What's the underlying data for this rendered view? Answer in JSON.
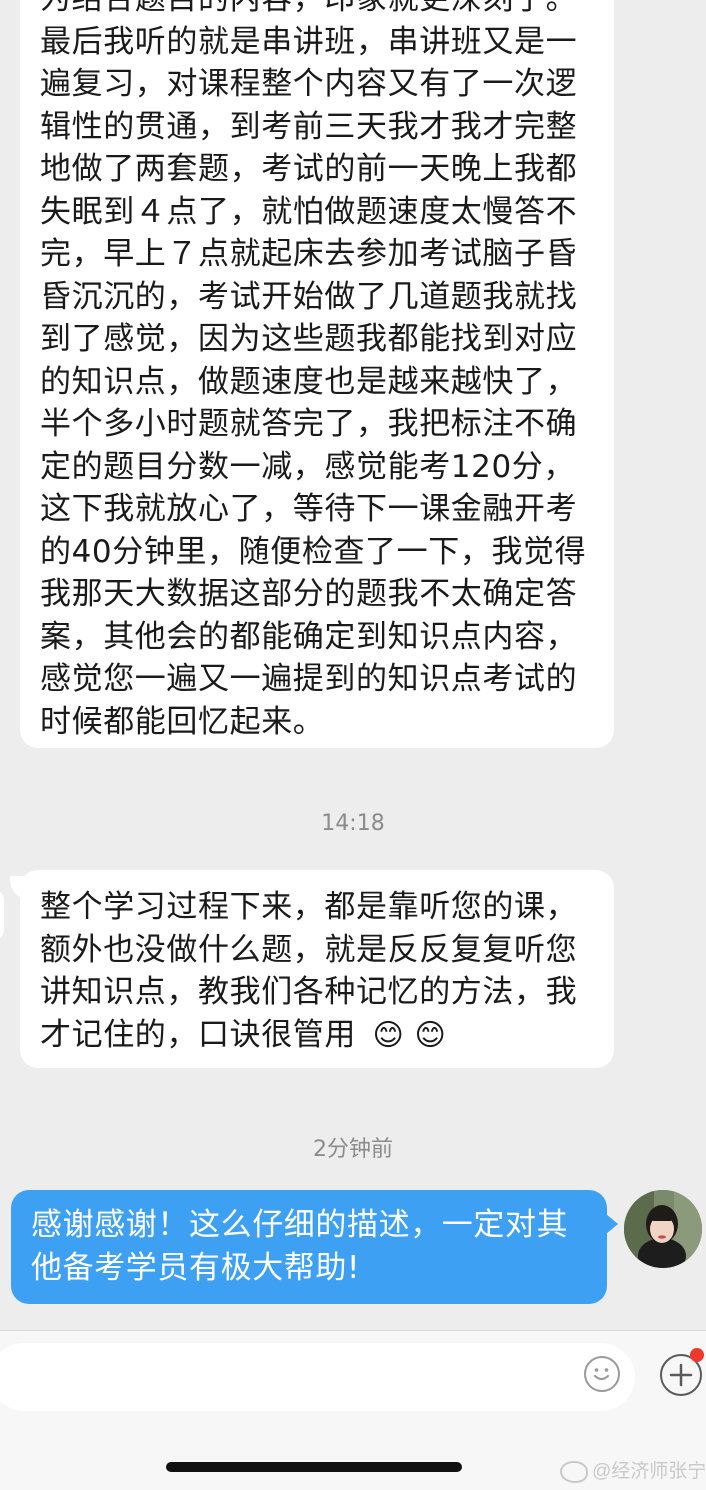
{
  "messages": [
    {
      "text": "为结合题目的内容，印象就更深刻了。最后我听的就是串讲班，串讲班又是一遍复习，对课程整个内容又有了一次逻辑性的贯通，到考前三天我才我才完整地做了两套题，考试的前一天晚上我都失眠到４点了，就怕做题速度太慢答不完，早上７点就起床去参加考试脑子昏昏沉沉的，考试开始做了几道题我就找到了感觉，因为这些题我都能找到对应的知识点，做题速度也是越来越快了，半个多小时题就答完了，我把标注不确定的题目分数一减，感觉能考120分，这下我就放心了，等待下一课金融开考的40分钟里，随便检查了一下，我觉得我那天大数据这部分的题我不太确定答案，其他会的都能确定到知识点内容，感觉您一遍又一遍提到的知识点考试的时候都能回忆起来。"
    },
    {
      "timestamp": "14:18",
      "text": "整个学习过程下来，都是靠听您的课，额外也没做什么题，就是反反复复听您讲知识点，教我们各种记忆的方法，我才记住的，口诀很管用",
      "emoji": "😊 😊"
    },
    {
      "timestamp": "2分钟前",
      "text": "感谢感谢！这么仔细的描述，一定对其他备考学员有极大帮助!"
    }
  ],
  "watermark": "@经济师张宁",
  "colors": {
    "background": "#ededed",
    "bubble_in": "#ffffff",
    "bubble_out": "#3ea0f3",
    "notification_dot": "#ee3a2e"
  },
  "icons": [
    "emoji-icon",
    "plus-icon",
    "weibo-logo-icon"
  ]
}
